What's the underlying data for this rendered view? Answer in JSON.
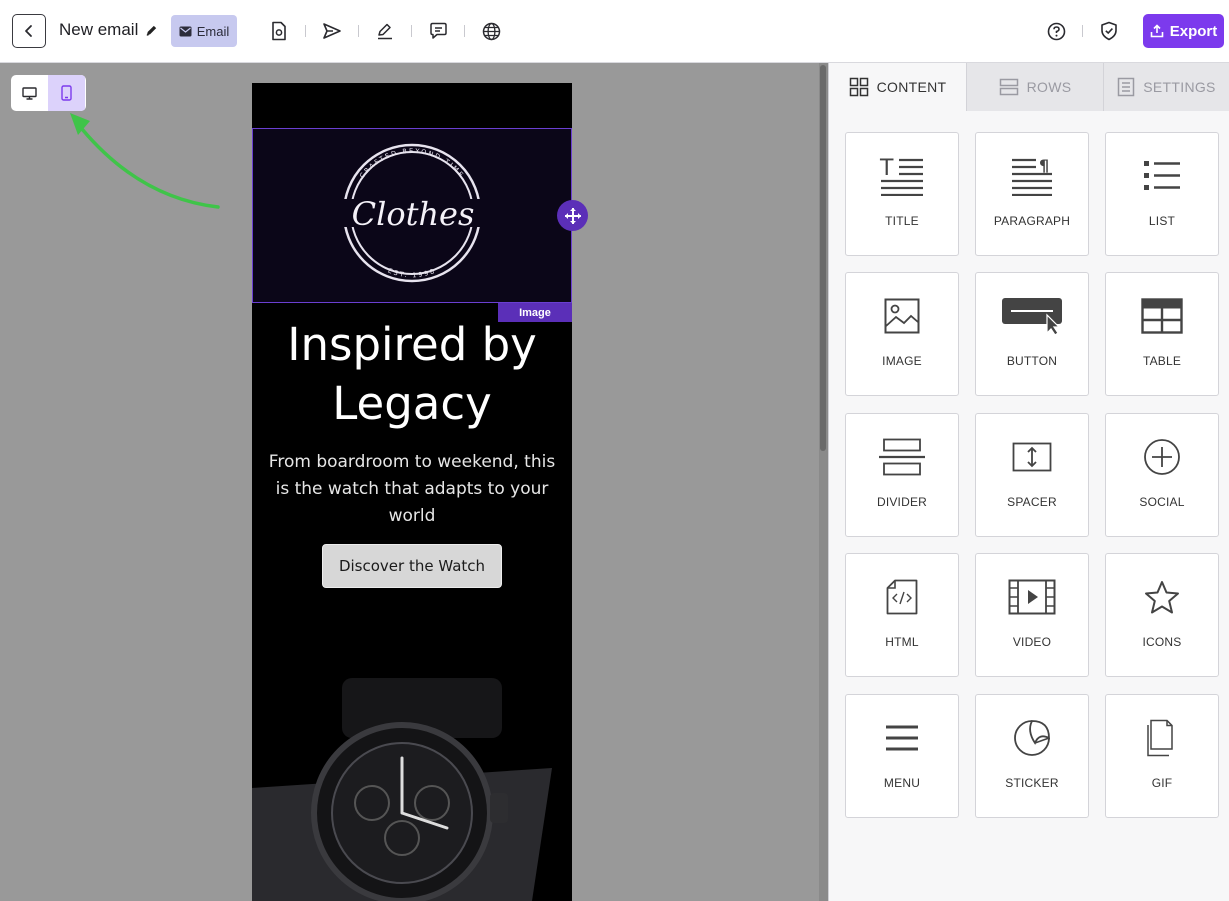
{
  "header": {
    "back_icon": "chevron-left-icon",
    "title": "New email",
    "mode_chip": "Email",
    "tools": [
      "settings-file-icon",
      "send-icon",
      "pen-icon",
      "comment-icon",
      "globe-icon"
    ],
    "help_icon": "question-circle-icon",
    "shield_icon": "shield-check-icon",
    "export_label": "Export"
  },
  "canvas": {
    "device_modes": [
      "desktop",
      "mobile"
    ],
    "active_device": "mobile",
    "selected_block_tag": "Image",
    "hero_title": "Inspired by Legacy",
    "hero_subtitle": "From boardroom to weekend, this is the watch that adapts to your world",
    "cta_label": "Discover the Watch",
    "logo_text": "Clothes",
    "logo_arc_top": "CRAFTED BEYOND TIME",
    "logo_arc_bottom": "EST. 1998"
  },
  "panel": {
    "tabs": [
      {
        "label": "CONTENT",
        "icon": "grid-icon",
        "active": true
      },
      {
        "label": "ROWS",
        "icon": "rows-icon",
        "active": false
      },
      {
        "label": "SETTINGS",
        "icon": "settings-list-icon",
        "active": false
      }
    ],
    "blocks": [
      {
        "label": "TITLE",
        "icon": "title-icon"
      },
      {
        "label": "PARAGRAPH",
        "icon": "paragraph-icon"
      },
      {
        "label": "LIST",
        "icon": "list-icon"
      },
      {
        "label": "IMAGE",
        "icon": "image-icon"
      },
      {
        "label": "BUTTON",
        "icon": "button-icon"
      },
      {
        "label": "TABLE",
        "icon": "table-icon"
      },
      {
        "label": "DIVIDER",
        "icon": "divider-icon"
      },
      {
        "label": "SPACER",
        "icon": "spacer-icon"
      },
      {
        "label": "SOCIAL",
        "icon": "social-icon"
      },
      {
        "label": "HTML",
        "icon": "html-icon"
      },
      {
        "label": "VIDEO",
        "icon": "video-icon"
      },
      {
        "label": "ICONS",
        "icon": "star-icon"
      },
      {
        "label": "MENU",
        "icon": "menu-icon"
      },
      {
        "label": "STICKER",
        "icon": "sticker-icon"
      },
      {
        "label": "GIF",
        "icon": "gif-icon"
      }
    ]
  },
  "colors": {
    "accent": "#7c3aed",
    "selection": "#5b2fb8",
    "canvas_bg": "#999999",
    "email_bg": "#000000"
  }
}
